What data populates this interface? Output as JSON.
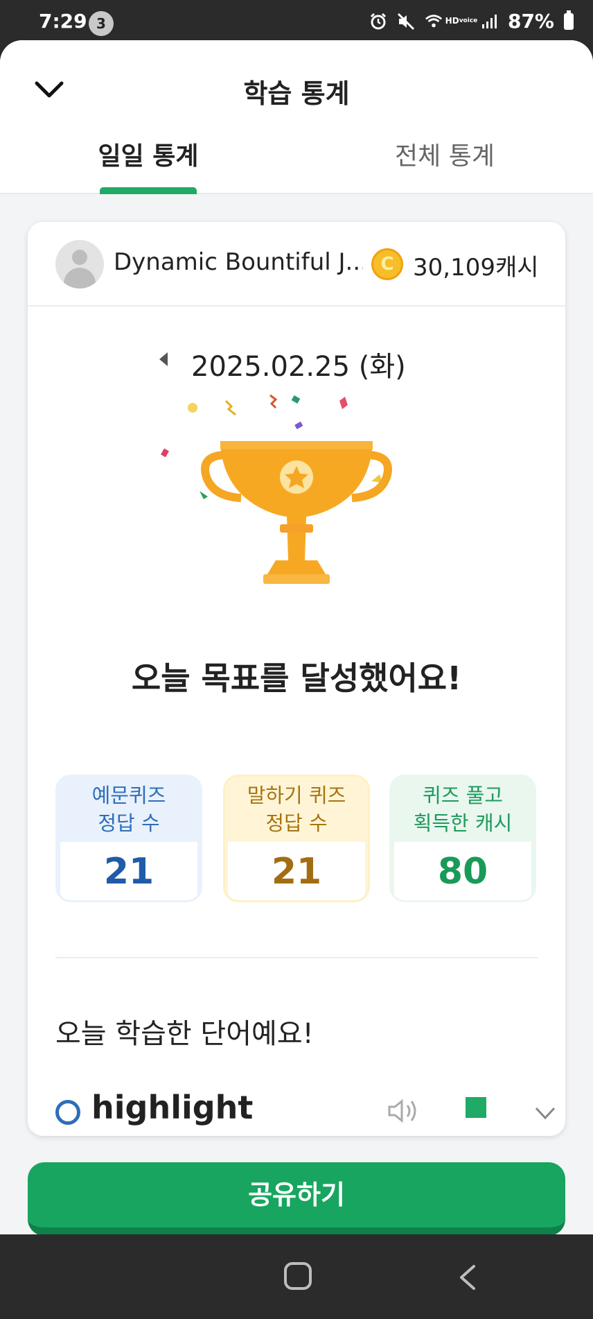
{
  "status_bar": {
    "time": "7:29",
    "notification_count": "3",
    "battery": "87%",
    "icons": [
      "alarm-icon",
      "mute-icon",
      "wifi-icon",
      "hd-voice-icon",
      "signal-icon",
      "battery-icon"
    ],
    "hd_top": "HD",
    "hd_bottom": "voice"
  },
  "header": {
    "title": "학습 통계",
    "tabs": [
      {
        "label": "일일 통계",
        "active": true
      },
      {
        "label": "전체 통계",
        "active": false
      }
    ]
  },
  "card": {
    "user_name": "Dynamic Bountiful J...",
    "coin_symbol": "C",
    "cash": "30,109캐시",
    "date": "2025.02.25 (화)",
    "goal_message": "오늘 목표를 달성했어요!",
    "stats": [
      {
        "line1": "예문퀴즈",
        "line2": "정답 수",
        "value": "21"
      },
      {
        "line1": "말하기 퀴즈",
        "line2": "정답 수",
        "value": "21"
      },
      {
        "line1": "퀴즈 풀고",
        "line2": "획득한 캐시",
        "value": "80"
      }
    ],
    "words_title": "오늘 학습한 단어예요!",
    "words": [
      {
        "word": "highlight"
      }
    ]
  },
  "share_button": {
    "label": "공유하기"
  },
  "colors": {
    "accent": "#1faa66",
    "stat_blue": "#1f5ba8",
    "stat_gold": "#a26d12",
    "stat_green": "#1a9a58",
    "trophy": "#f7a823"
  }
}
